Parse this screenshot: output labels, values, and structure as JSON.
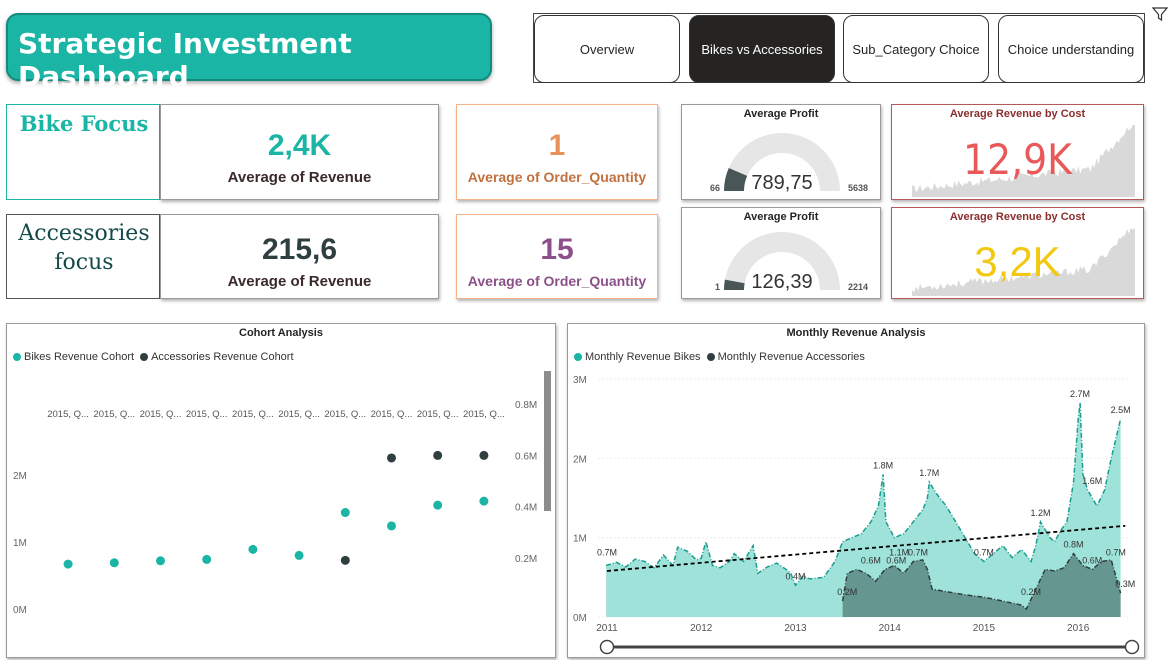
{
  "header": {
    "title": "Strategic Investment Dashboard"
  },
  "nav": {
    "tabs": [
      {
        "label": "Overview",
        "active": false
      },
      {
        "label": "Bikes vs Accessories",
        "active": true
      },
      {
        "label": "Sub_Category Choice",
        "active": false
      },
      {
        "label": "Choice understanding",
        "active": false
      }
    ]
  },
  "icons": {
    "filter": "filter-icon"
  },
  "colors": {
    "teal": "#1ab5a4",
    "dark": "#2f3e3f",
    "orange": "#e8915a",
    "purple": "#8b5089",
    "red": "#e85a5a",
    "yellow": "#f2c811"
  },
  "bike": {
    "label": "Bike Focus",
    "revenue_value": "2,4K",
    "revenue_label": "Average of Revenue",
    "qty_value": "1",
    "qty_label": "Average of Order_Quantity",
    "profit_title": "Average Profit",
    "profit_value": "789,75",
    "profit_min": "66",
    "profit_max": "5638",
    "profit_fraction": 0.13,
    "rev_cost_title": "Average Revenue by Cost",
    "rev_cost_value": "12,9K"
  },
  "accessories": {
    "label": "Accessories focus",
    "revenue_value": "215,6",
    "revenue_label": "Average of Revenue",
    "qty_value": "15",
    "qty_label": "Average of Order_Quantity",
    "profit_title": "Average Profit",
    "profit_value": "126,39",
    "profit_min": "1",
    "profit_max": "2214",
    "profit_fraction": 0.057,
    "rev_cost_title": "Average Revenue by Cost",
    "rev_cost_value": "3,2K"
  },
  "cohort": {
    "title": "Cohort Analysis",
    "legend": [
      "Bikes Revenue Cohort",
      "Accessories Revenue Cohort"
    ]
  },
  "monthly": {
    "title": "Monthly Revenue Analysis",
    "legend": [
      "Monthly Revenue Bikes",
      "Monthly Revenue Accessories"
    ]
  },
  "chart_data": [
    {
      "type": "scatter",
      "title": "Cohort Analysis",
      "categories": [
        "2015, Q...",
        "2015, Q...",
        "2015, Q...",
        "2015, Q...",
        "2015, Q...",
        "2015, Q...",
        "2015, Q...",
        "2015, Q...",
        "2015, Q...",
        "2015, Q..."
      ],
      "y_left_ticks": [
        "0M",
        "1M",
        "2M"
      ],
      "y_right_ticks": [
        "0.2M",
        "0.4M",
        "0.6M",
        "0.8M"
      ],
      "ylim_left": [
        0,
        2.5
      ],
      "ylim_right": [
        0,
        0.95
      ],
      "series": [
        {
          "name": "Bikes Revenue Cohort",
          "axis": "left",
          "color": "#1ab5a4",
          "values": [
            0.67,
            0.69,
            0.72,
            0.74,
            0.89,
            0.8,
            1.44,
            1.24,
            1.55,
            1.61
          ]
        },
        {
          "name": "Accessories Revenue Cohort",
          "axis": "right",
          "color": "#2f3e3f",
          "values": [
            null,
            null,
            null,
            null,
            null,
            null,
            0.19,
            0.59,
            0.6,
            0.6
          ]
        }
      ]
    },
    {
      "type": "area",
      "title": "Monthly Revenue Analysis",
      "x_ticks": [
        "2011",
        "2012",
        "2013",
        "2014",
        "2015",
        "2016"
      ],
      "y_ticks": [
        "0M",
        "1M",
        "2M",
        "3M"
      ],
      "ylim": [
        0,
        3
      ],
      "series": [
        {
          "name": "Monthly Revenue Bikes",
          "color": "#1ab5a4",
          "points": [
            [
              2010.99,
              0.65
            ],
            [
              2011.1,
              0.69
            ],
            [
              2011.2,
              0.63
            ],
            [
              2011.3,
              0.73
            ],
            [
              2011.4,
              0.7
            ],
            [
              2011.5,
              0.62
            ],
            [
              2011.6,
              0.78
            ],
            [
              2011.7,
              0.65
            ],
            [
              2011.75,
              0.88
            ],
            [
              2011.85,
              0.83
            ],
            [
              2011.95,
              0.72
            ],
            [
              2012.0,
              0.74
            ],
            [
              2012.05,
              0.95
            ],
            [
              2012.12,
              0.65
            ],
            [
              2012.2,
              0.62
            ],
            [
              2012.3,
              0.7
            ],
            [
              2012.35,
              0.8
            ],
            [
              2012.45,
              0.7
            ],
            [
              2012.55,
              0.9
            ],
            [
              2012.6,
              0.55
            ],
            [
              2012.7,
              0.63
            ],
            [
              2012.8,
              0.68
            ],
            [
              2012.9,
              0.6
            ],
            [
              2012.95,
              0.55
            ],
            [
              2013.0,
              0.4
            ],
            [
              2013.08,
              0.52
            ],
            [
              2013.15,
              0.48
            ],
            [
              2013.3,
              0.5
            ],
            [
              2013.42,
              0.7
            ],
            [
              2013.5,
              0.95
            ],
            [
              2013.6,
              1.0
            ],
            [
              2013.7,
              1.05
            ],
            [
              2013.8,
              1.2
            ],
            [
              2013.88,
              1.4
            ],
            [
              2013.93,
              1.8
            ],
            [
              2013.96,
              1.2
            ],
            [
              2014.05,
              1.0
            ],
            [
              2014.15,
              1.05
            ],
            [
              2014.25,
              1.2
            ],
            [
              2014.35,
              1.35
            ],
            [
              2014.4,
              1.5
            ],
            [
              2014.42,
              1.7
            ],
            [
              2014.5,
              1.55
            ],
            [
              2014.6,
              1.4
            ],
            [
              2014.7,
              1.2
            ],
            [
              2014.8,
              1.0
            ],
            [
              2014.9,
              0.8
            ],
            [
              2015.0,
              0.7
            ],
            [
              2015.1,
              0.8
            ],
            [
              2015.2,
              0.9
            ],
            [
              2015.3,
              0.75
            ],
            [
              2015.4,
              0.85
            ],
            [
              2015.5,
              0.7
            ],
            [
              2015.55,
              0.9
            ],
            [
              2015.6,
              1.2
            ],
            [
              2015.7,
              1.0
            ],
            [
              2015.75,
              0.95
            ],
            [
              2015.82,
              1.1
            ],
            [
              2015.88,
              1.2
            ],
            [
              2015.95,
              1.7
            ],
            [
              2016.0,
              2.5
            ],
            [
              2016.02,
              2.7
            ],
            [
              2016.05,
              1.8
            ],
            [
              2016.1,
              1.6
            ],
            [
              2016.2,
              1.4
            ],
            [
              2016.28,
              1.6
            ],
            [
              2016.35,
              2.0
            ],
            [
              2016.45,
              2.5
            ]
          ]
        },
        {
          "name": "Monthly Revenue Accessories",
          "color": "#2f3e3f",
          "points": [
            [
              2013.5,
              0.2
            ],
            [
              2013.55,
              0.55
            ],
            [
              2013.65,
              0.6
            ],
            [
              2013.75,
              0.55
            ],
            [
              2013.85,
              0.45
            ],
            [
              2013.95,
              0.6
            ],
            [
              2014.05,
              0.65
            ],
            [
              2014.15,
              0.55
            ],
            [
              2014.25,
              0.7
            ],
            [
              2014.35,
              0.72
            ],
            [
              2014.4,
              0.6
            ],
            [
              2014.45,
              0.35
            ],
            [
              2014.6,
              0.32
            ],
            [
              2014.8,
              0.28
            ],
            [
              2015.0,
              0.25
            ],
            [
              2015.2,
              0.2
            ],
            [
              2015.4,
              0.15
            ],
            [
              2015.45,
              0.1
            ],
            [
              2015.55,
              0.35
            ],
            [
              2015.65,
              0.6
            ],
            [
              2015.75,
              0.58
            ],
            [
              2015.85,
              0.62
            ],
            [
              2015.95,
              0.8
            ],
            [
              2016.05,
              0.65
            ],
            [
              2016.15,
              0.6
            ],
            [
              2016.25,
              0.7
            ],
            [
              2016.35,
              0.72
            ],
            [
              2016.45,
              0.3
            ]
          ]
        }
      ],
      "data_labels": [
        {
          "x": 2011.0,
          "y": 0.7,
          "text": "0.7M",
          "color": "#333"
        },
        {
          "x": 2013.0,
          "y": 0.4,
          "text": "0.4M",
          "color": "#333"
        },
        {
          "x": 2013.55,
          "y": 0.2,
          "text": "0.2M",
          "color": "#333"
        },
        {
          "x": 2013.8,
          "y": 0.6,
          "text": "0.6M",
          "color": "#333"
        },
        {
          "x": 2013.93,
          "y": 1.8,
          "text": "1.8M",
          "color": "#333"
        },
        {
          "x": 2014.1,
          "y": 0.7,
          "text": "1.1M",
          "color": "#333"
        },
        {
          "x": 2014.3,
          "y": 0.7,
          "text": "0.7M",
          "color": "#333"
        },
        {
          "x": 2014.07,
          "y": 0.6,
          "text": "0.6M",
          "color": "#333"
        },
        {
          "x": 2014.42,
          "y": 1.7,
          "text": "1.7M",
          "color": "#333"
        },
        {
          "x": 2015.0,
          "y": 0.7,
          "text": "0.7M",
          "color": "#333"
        },
        {
          "x": 2015.5,
          "y": 0.2,
          "text": "0.2M",
          "color": "#333"
        },
        {
          "x": 2015.6,
          "y": 1.2,
          "text": "1.2M",
          "color": "#333"
        },
        {
          "x": 2015.95,
          "y": 0.8,
          "text": "0.8M",
          "color": "#333"
        },
        {
          "x": 2016.02,
          "y": 2.7,
          "text": "2.7M",
          "color": "#333"
        },
        {
          "x": 2016.15,
          "y": 1.6,
          "text": "1.6M",
          "color": "#333"
        },
        {
          "x": 2016.15,
          "y": 0.6,
          "text": "0.6M",
          "color": "#333"
        },
        {
          "x": 2016.4,
          "y": 0.7,
          "text": "0.7M",
          "color": "#333"
        },
        {
          "x": 2016.45,
          "y": 2.5,
          "text": "2.5M",
          "color": "#333"
        },
        {
          "x": 2016.5,
          "y": 0.3,
          "text": "0.3M",
          "color": "#333"
        }
      ],
      "trendline": {
        "from": [
          2011.0,
          0.58
        ],
        "to": [
          2016.5,
          1.15
        ]
      }
    }
  ]
}
